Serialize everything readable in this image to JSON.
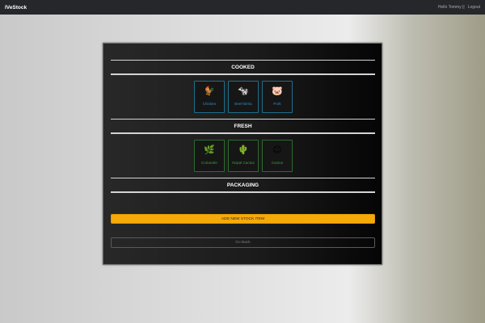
{
  "navbar": {
    "brand": "IVeStock",
    "greeting": "Hello Tommy ||",
    "logout": "Logout"
  },
  "sections": [
    {
      "title": "COOKED",
      "items": [
        {
          "emoji": "🐓",
          "icon": "chicken-icon",
          "label": "Chicken"
        },
        {
          "emoji": "🐄",
          "icon": "cow-icon",
          "label": "Beef Birria"
        },
        {
          "emoji": "🐷",
          "icon": "pig-icon",
          "label": "Pork"
        }
      ]
    },
    {
      "title": "FRESH",
      "items": [
        {
          "emoji": "🌿",
          "icon": "herb-icon",
          "label": "Coriander"
        },
        {
          "emoji": "🌵",
          "icon": "cactus-icon",
          "label": "Nopal Cactus"
        },
        {
          "emoji": "😊",
          "icon": "smiley-icon",
          "label": "Cactus"
        }
      ]
    },
    {
      "title": "PACKAGING",
      "items": []
    }
  ],
  "actions": {
    "add_label": "ADD NEW STOCK ITEM",
    "back_label": "Go Back"
  },
  "colors": {
    "cooked_border": "#1d6f8c",
    "cooked_text": "#2f8cc4",
    "fresh_border": "#2d6b2d",
    "fresh_text": "#34a43a",
    "add_button": "#f5aa0a"
  }
}
